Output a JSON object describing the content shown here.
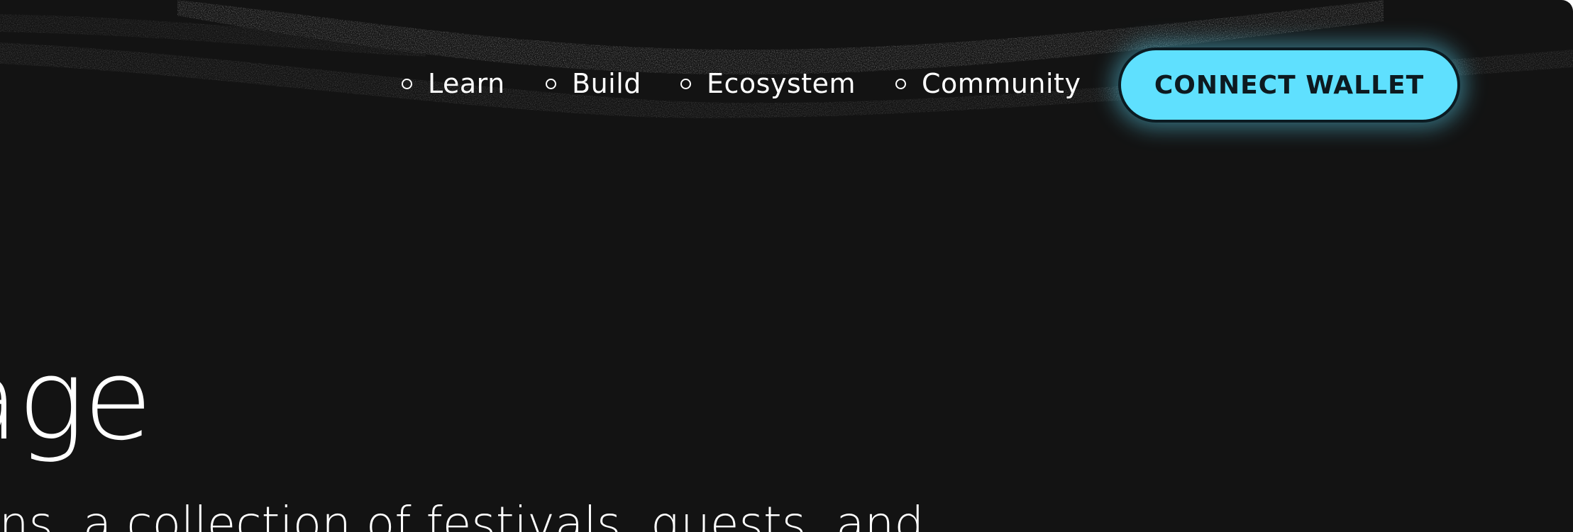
{
  "nav": {
    "items": [
      {
        "label": "Learn"
      },
      {
        "label": "Build"
      },
      {
        "label": "Ecosystem"
      },
      {
        "label": "Community"
      }
    ],
    "cta_label": "CONNECT WALLET"
  },
  "hero": {
    "heading_fragment": "age",
    "subtitle_fragment": "ions, a collection of festivals, quests, and"
  },
  "colors": {
    "background": "#131313",
    "accent": "#5fe0fe",
    "text": "#ffffff"
  }
}
